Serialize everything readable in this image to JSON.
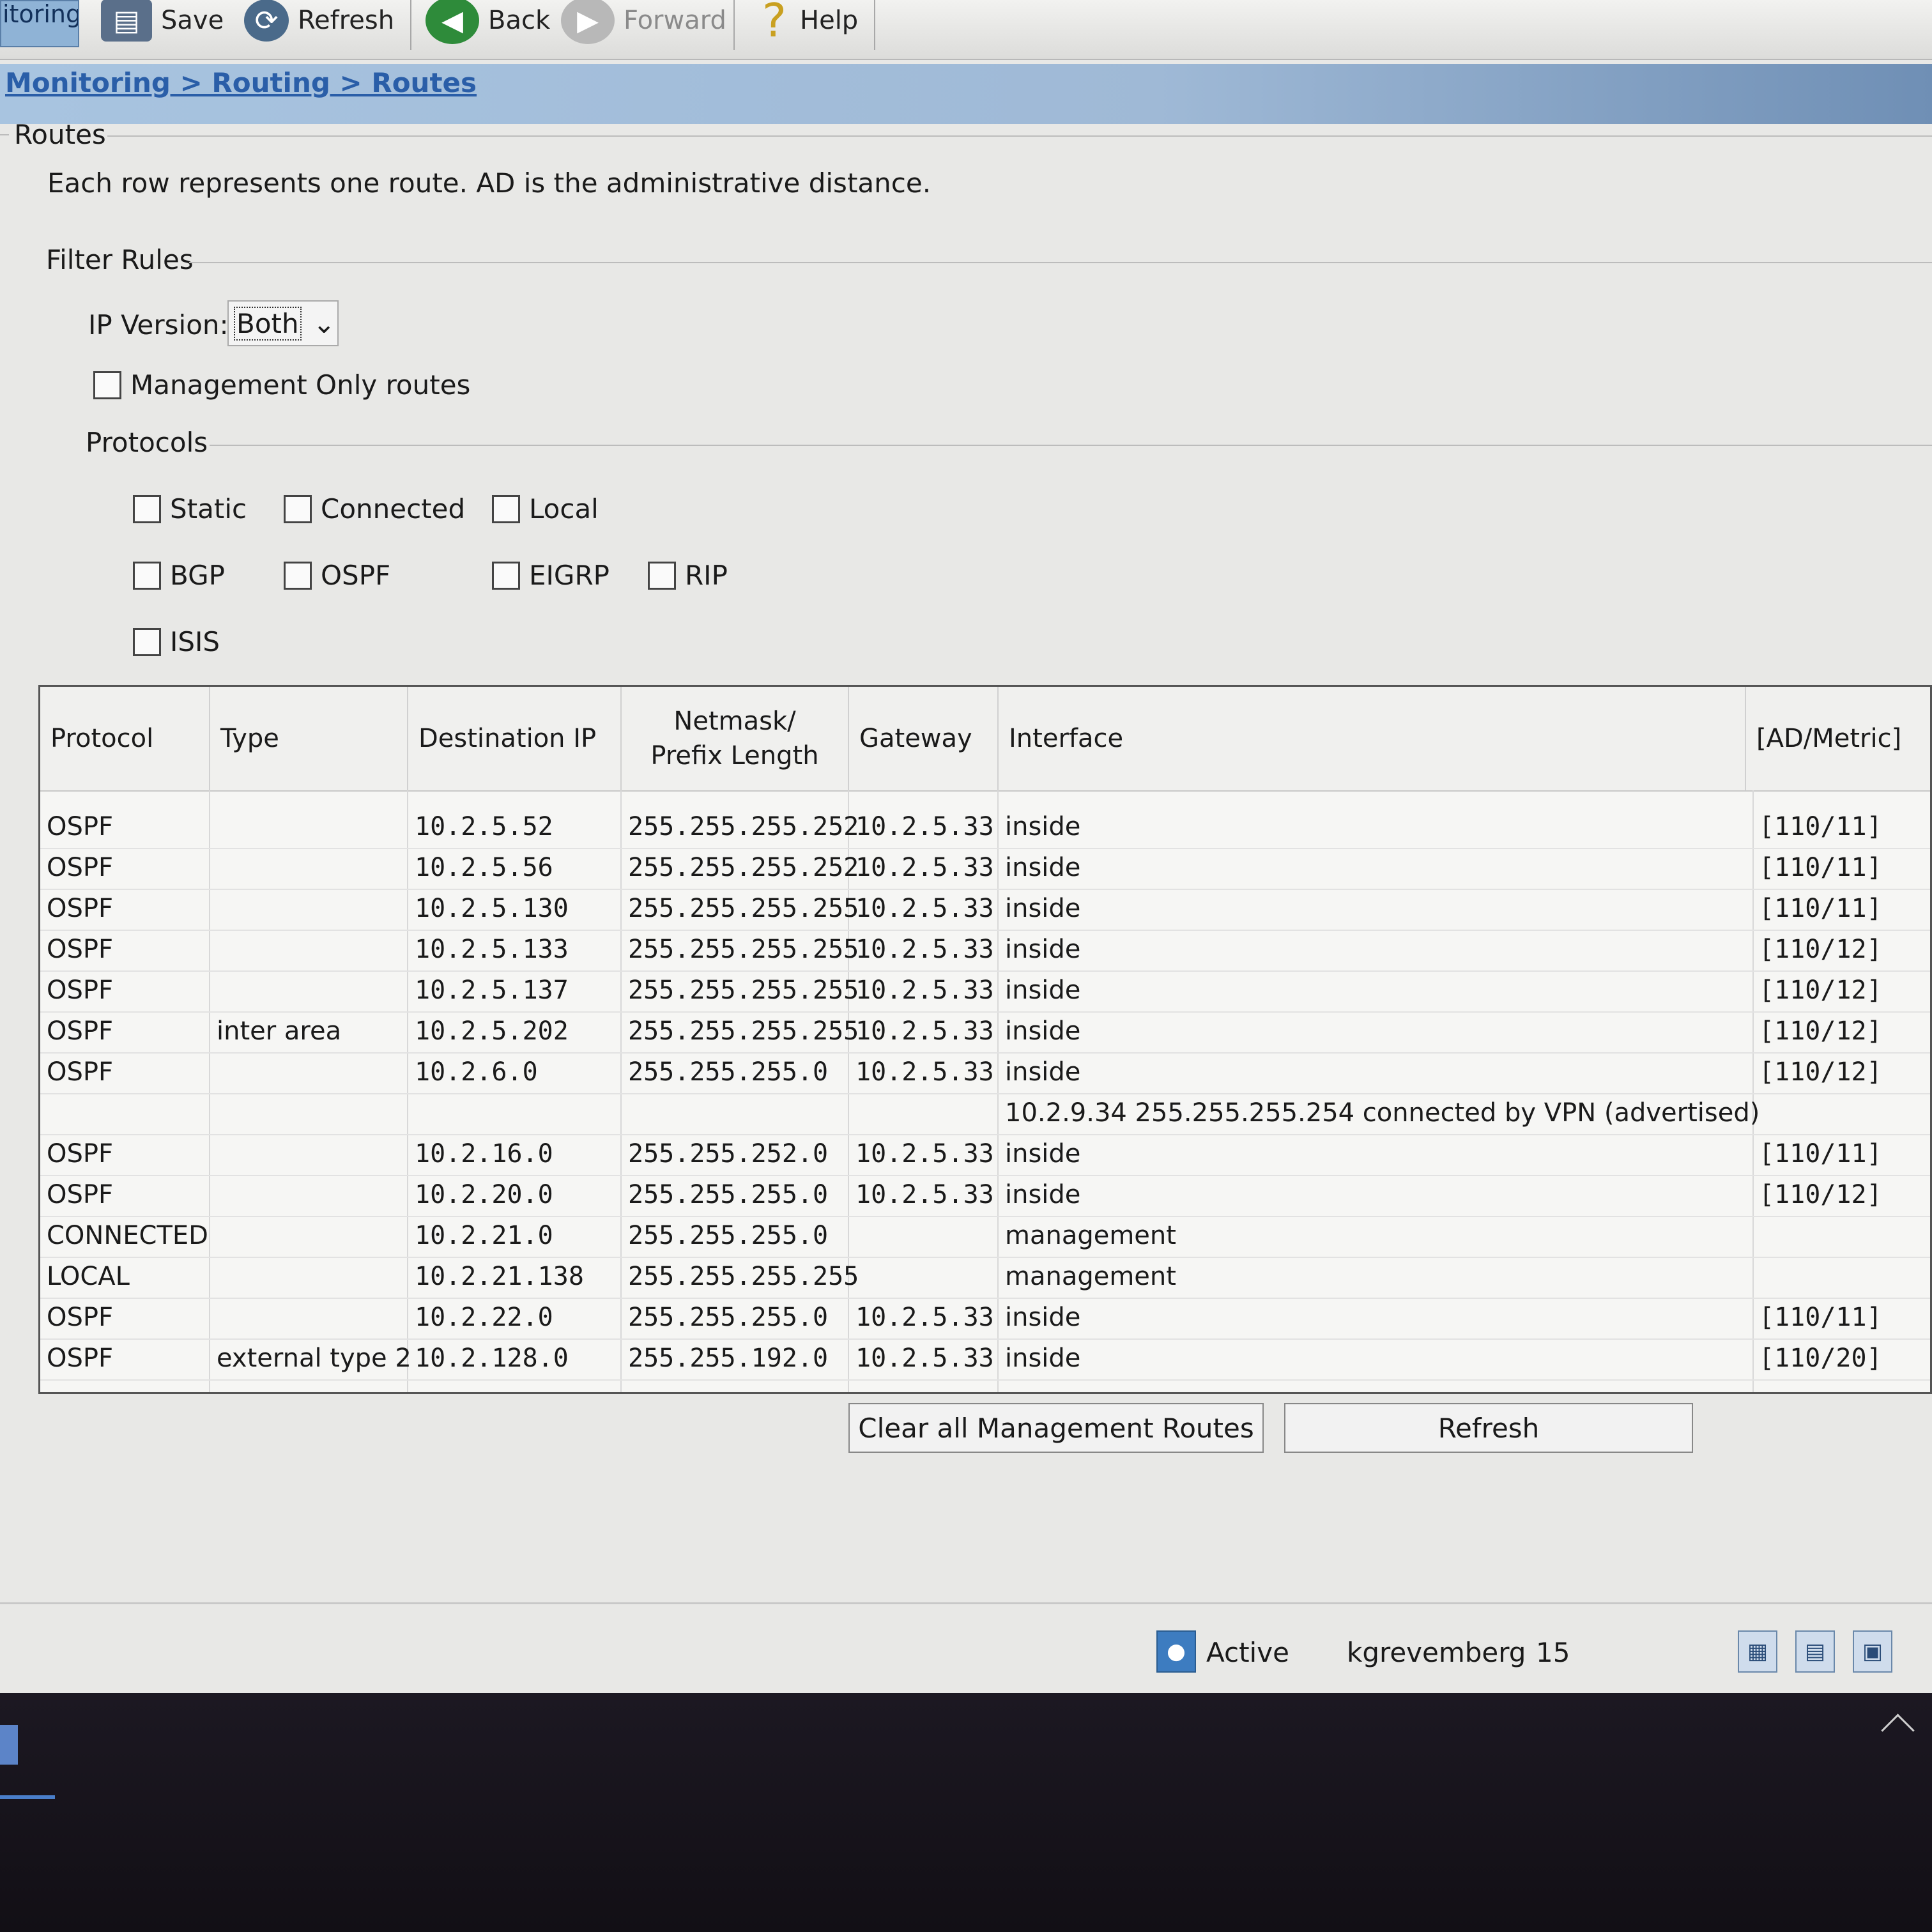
{
  "toolbar": {
    "tab_fragment": "itoring",
    "save": "Save",
    "refresh": "Refresh",
    "back": "Back",
    "forward": "Forward",
    "help": "Help"
  },
  "breadcrumb": "Monitoring > Routing > Routes",
  "section_title": "Routes",
  "description": "Each row represents one route. AD is the administrative distance.",
  "filter": {
    "title": "Filter Rules",
    "ip_version_label": "IP Version:",
    "ip_version_value": "Both",
    "management_only": "Management Only routes",
    "protocols_title": "Protocols",
    "protocols": [
      "Static",
      "Connected",
      "Local",
      "BGP",
      "OSPF",
      "EIGRP",
      "RIP",
      "ISIS"
    ]
  },
  "table": {
    "headers": {
      "protocol": "Protocol",
      "type": "Type",
      "destination": "Destination IP",
      "netmask_1": "Netmask/",
      "netmask_2": "Prefix Length",
      "gateway": "Gateway",
      "interface": "Interface",
      "ad_metric": "[AD/Metric]"
    },
    "rows": [
      {
        "protocol": "OSPF",
        "type": "",
        "dest": "10.2.5.52",
        "mask": "255.255.255.252",
        "gw": "10.2.5.33",
        "iface": "inside",
        "ad": "[110/11]"
      },
      {
        "protocol": "OSPF",
        "type": "",
        "dest": "10.2.5.56",
        "mask": "255.255.255.252",
        "gw": "10.2.5.33",
        "iface": "inside",
        "ad": "[110/11]"
      },
      {
        "protocol": "OSPF",
        "type": "",
        "dest": "10.2.5.130",
        "mask": "255.255.255.255",
        "gw": "10.2.5.33",
        "iface": "inside",
        "ad": "[110/11]"
      },
      {
        "protocol": "OSPF",
        "type": "",
        "dest": "10.2.5.133",
        "mask": "255.255.255.255",
        "gw": "10.2.5.33",
        "iface": "inside",
        "ad": "[110/12]"
      },
      {
        "protocol": "OSPF",
        "type": "",
        "dest": "10.2.5.137",
        "mask": "255.255.255.255",
        "gw": "10.2.5.33",
        "iface": "inside",
        "ad": "[110/12]"
      },
      {
        "protocol": "OSPF",
        "type": "inter area",
        "dest": "10.2.5.202",
        "mask": "255.255.255.255",
        "gw": "10.2.5.33",
        "iface": "inside",
        "ad": "[110/12]"
      },
      {
        "protocol": "OSPF",
        "type": "",
        "dest": "10.2.6.0",
        "mask": "255.255.255.0",
        "gw": "10.2.5.33",
        "iface": "inside",
        "ad": "[110/12]"
      },
      {
        "protocol": "",
        "type": "",
        "dest": "",
        "mask": "",
        "gw": "",
        "iface": "10.2.9.34 255.255.255.254 connected by VPN (advertised)",
        "ad": ""
      },
      {
        "protocol": "OSPF",
        "type": "",
        "dest": "10.2.16.0",
        "mask": "255.255.252.0",
        "gw": "10.2.5.33",
        "iface": "inside",
        "ad": "[110/11]"
      },
      {
        "protocol": "OSPF",
        "type": "",
        "dest": "10.2.20.0",
        "mask": "255.255.255.0",
        "gw": "10.2.5.33",
        "iface": "inside",
        "ad": "[110/12]"
      },
      {
        "protocol": "CONNECTED",
        "type": "",
        "dest": "10.2.21.0",
        "mask": "255.255.255.0",
        "gw": "",
        "iface": "management",
        "ad": ""
      },
      {
        "protocol": "LOCAL",
        "type": "",
        "dest": "10.2.21.138",
        "mask": "255.255.255.255",
        "gw": "",
        "iface": "management",
        "ad": ""
      },
      {
        "protocol": "OSPF",
        "type": "",
        "dest": "10.2.22.0",
        "mask": "255.255.255.0",
        "gw": "10.2.5.33",
        "iface": "inside",
        "ad": "[110/11]"
      },
      {
        "protocol": "OSPF",
        "type": "external type 2",
        "dest": "10.2.128.0",
        "mask": "255.255.192.0",
        "gw": "10.2.5.33",
        "iface": "inside",
        "ad": "[110/20]"
      }
    ]
  },
  "buttons": {
    "clear_management": "Clear all Management Routes",
    "refresh": "Refresh"
  },
  "status": {
    "state": "Active",
    "user": "kgrevemberg",
    "count": "15"
  },
  "icons": [
    "save-icon",
    "refresh-icon",
    "back-icon",
    "forward-icon",
    "help-icon",
    "status-active-icon",
    "monitor-icon",
    "config-icon",
    "connect-icon"
  ],
  "colors": {
    "breadcrumb_link": "#2a5ea8",
    "breadcrumb_bar": "#9fb9d6",
    "back_icon": "#2e8b3a"
  }
}
